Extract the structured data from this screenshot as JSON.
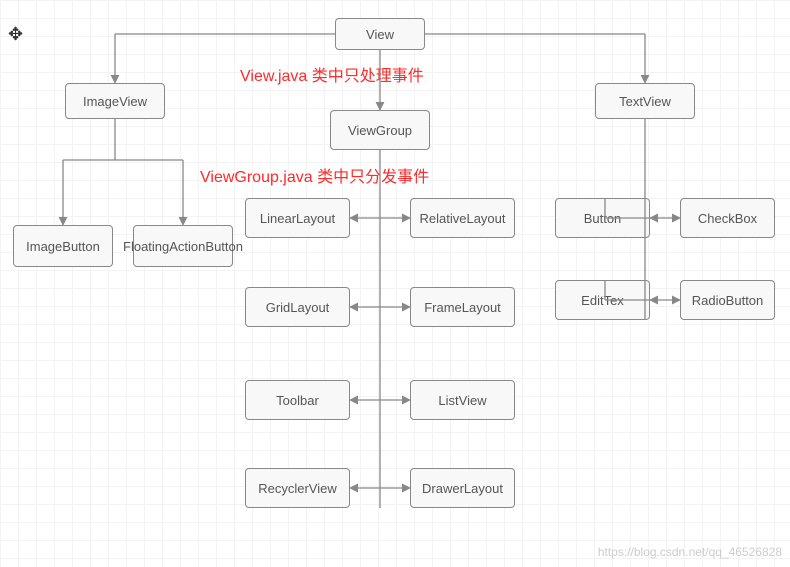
{
  "root": "View",
  "annotations": {
    "view_note": "View.java 类中只处理事件",
    "viewgroup_note": "ViewGroup.java 类中只分发事件"
  },
  "branches": {
    "imageview": {
      "label": "ImageView",
      "children": {
        "imagebutton": "ImageButton",
        "fab": "FloatingActionButton"
      }
    },
    "viewgroup": {
      "label": "ViewGroup",
      "pairs": [
        {
          "left": "LinearLayout",
          "right": "RelativeLayout"
        },
        {
          "left": "GridLayout",
          "right": "FrameLayout"
        },
        {
          "left": "Toolbar",
          "right": "ListView"
        },
        {
          "left": "RecyclerView",
          "right": "DrawerLayout"
        }
      ]
    },
    "textview": {
      "label": "TextView",
      "pairs": [
        {
          "left": "Button",
          "right": "CheckBox"
        },
        {
          "left": "EditTex",
          "right": "RadioButton"
        }
      ]
    }
  },
  "watermark": "https://blog.csdn.net/qq_46526828"
}
